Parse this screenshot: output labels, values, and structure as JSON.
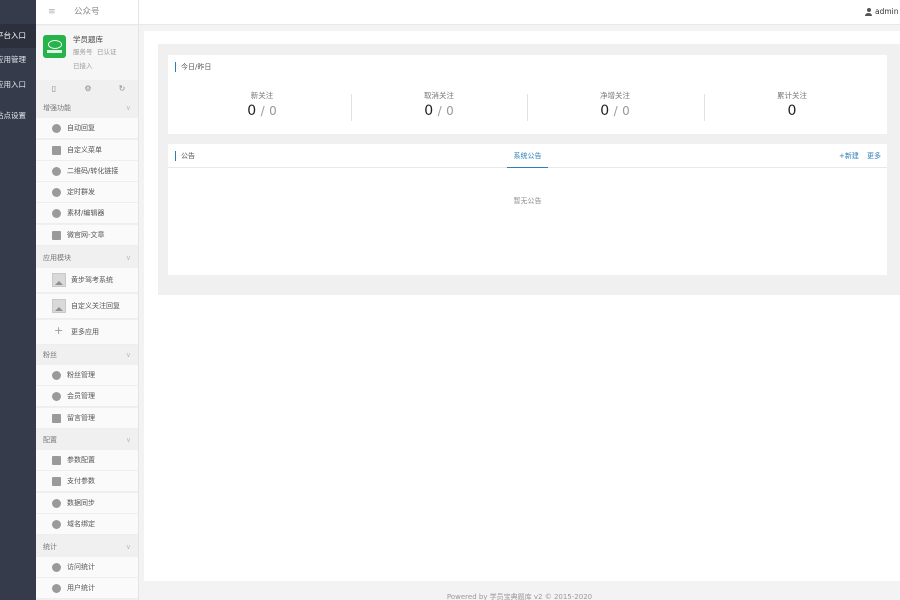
{
  "rail": {
    "items": [
      {
        "label": "平台入口",
        "active": true
      },
      {
        "label": "应用管理",
        "active": false
      },
      {
        "label": "应用入口",
        "active": false
      },
      {
        "label": "站点设置",
        "active": false
      }
    ]
  },
  "sidebar": {
    "menu_icon": "≡",
    "title": "公众号",
    "account": {
      "name": "学员题库",
      "type": "服务号",
      "verified": "已认证",
      "status": "已接入"
    },
    "tools": [
      {
        "icon": "mobile-icon",
        "glyph": "▯"
      },
      {
        "icon": "gear-icon",
        "glyph": "⚙"
      },
      {
        "icon": "refresh-icon",
        "glyph": "↻"
      }
    ],
    "sections": [
      {
        "label": "增强功能",
        "items": [
          {
            "label": "自动回复",
            "icon": "chat-icon"
          },
          {
            "label": "自定义菜单",
            "icon": "menu-doc-icon"
          },
          {
            "label": "二维码/转化链接",
            "icon": "qrcode-icon"
          },
          {
            "label": "定时群发",
            "icon": "clock-icon"
          },
          {
            "label": "素材/编辑器",
            "icon": "edit-icon"
          },
          {
            "label": "微官网-文章",
            "icon": "home-icon"
          }
        ]
      },
      {
        "label": "应用模块",
        "items": [
          {
            "label": "黄步驾考系统",
            "icon": "image-placeholder-icon"
          },
          {
            "label": "自定义关注回复",
            "icon": "image-placeholder-icon"
          },
          {
            "label": "更多应用",
            "icon": "plus-icon"
          }
        ]
      },
      {
        "label": "粉丝",
        "items": [
          {
            "label": "粉丝管理",
            "icon": "heart-icon"
          },
          {
            "label": "会员管理",
            "icon": "heart-icon"
          },
          {
            "label": "留言管理",
            "icon": "mail-icon"
          }
        ]
      },
      {
        "label": "配置",
        "items": [
          {
            "label": "参数配置",
            "icon": "list-icon"
          },
          {
            "label": "支付参数",
            "icon": "card-icon"
          },
          {
            "label": "数据同步",
            "icon": "sync-icon"
          },
          {
            "label": "域名绑定",
            "icon": "link-icon"
          }
        ]
      },
      {
        "label": "统计",
        "items": [
          {
            "label": "访问统计",
            "icon": "chart-icon"
          },
          {
            "label": "用户统计",
            "icon": "user-stat-icon"
          }
        ]
      }
    ]
  },
  "topbar": {
    "user": "admin ▾"
  },
  "stats": {
    "title": "今日/昨日",
    "items": [
      {
        "label": "新关注",
        "today": "0",
        "sep": "/",
        "yesterday": "0"
      },
      {
        "label": "取消关注",
        "today": "0",
        "sep": "/",
        "yesterday": "0"
      },
      {
        "label": "净增关注",
        "today": "0",
        "sep": "/",
        "yesterday": "0"
      },
      {
        "label": "累计关注",
        "today": "0",
        "sep": "",
        "yesterday": ""
      }
    ]
  },
  "notice": {
    "title": "公告",
    "tab": "系统公告",
    "new": "+新建",
    "more": "更多",
    "empty": "暂无公告"
  },
  "footer": {
    "text": "Powered by 学员宝典题库 v2 © 2015-2020"
  },
  "colors": {
    "rail_bg": "#353b4a",
    "accent": "#2c7fb8",
    "logo_green": "#25b34a"
  }
}
